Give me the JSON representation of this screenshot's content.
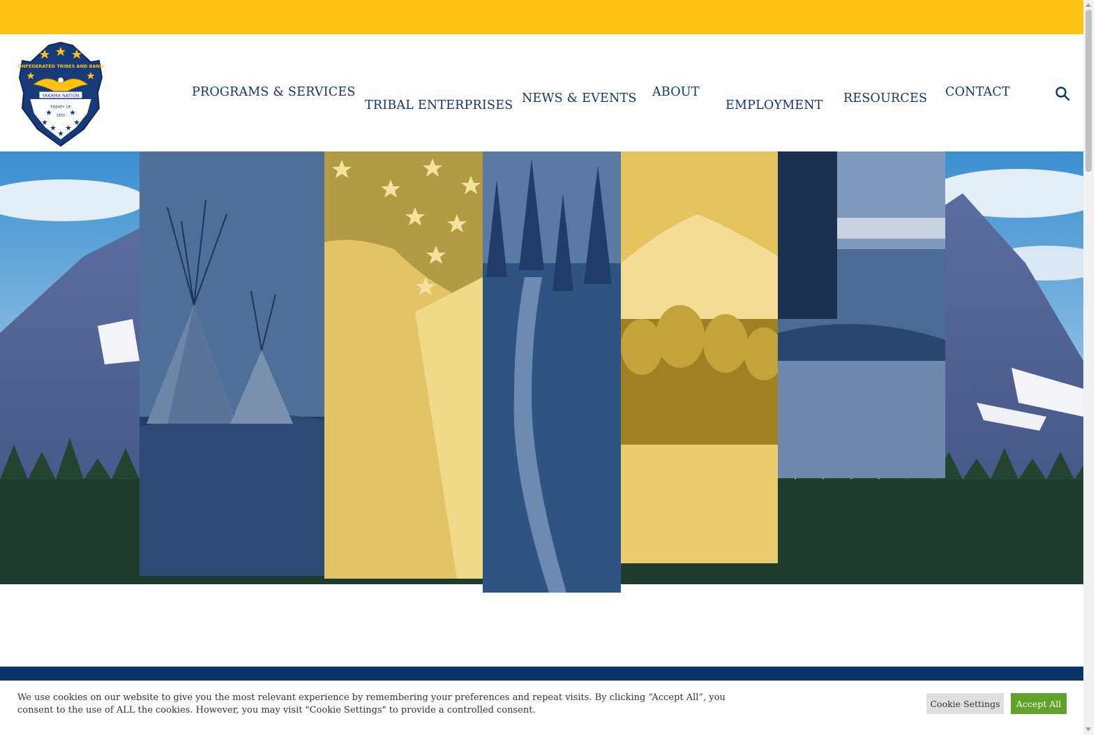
{
  "colors": {
    "gold": "#fdc113",
    "navy": "#0d3672",
    "band": "#0b336d",
    "accept_green": "#61a229"
  },
  "logo": {
    "icon": "yakama-nation-seal-icon",
    "ring_text": "CONFEDERATED TRIBES AND BANDS",
    "banner_text": "YAKAMA NATION",
    "treaty_text": "TREATY OF",
    "year_text": "1855"
  },
  "nav": {
    "items": [
      {
        "label": "PROGRAMS & SERVICES"
      },
      {
        "label": "TRIBAL ENTERPRISES"
      },
      {
        "label": "NEWS & EVENTS"
      },
      {
        "label": "ABOUT"
      },
      {
        "label": "EMPLOYMENT"
      },
      {
        "label": "RESOURCES"
      },
      {
        "label": "CONTACT"
      }
    ],
    "search_icon": "search-icon"
  },
  "hero": {
    "background": "mountain-forest-landscape",
    "panels": [
      {
        "subject": "teepees",
        "tint": "navy"
      },
      {
        "subject": "american-flag",
        "tint": "gold"
      },
      {
        "subject": "forest-trail",
        "tint": "navy"
      },
      {
        "subject": "mountain-aspen-meadow",
        "tint": "gold"
      },
      {
        "subject": "dam-and-barn",
        "tint": "navy"
      }
    ]
  },
  "cookie": {
    "text": "We use cookies on our website to give you the most relevant experience by remembering your preferences and repeat visits. By clicking “Accept All”, you consent to the use of ALL the cookies. However, you may visit \"Cookie Settings\" to provide a controlled consent.",
    "settings_label": "Cookie Settings",
    "accept_label": "Accept All"
  }
}
